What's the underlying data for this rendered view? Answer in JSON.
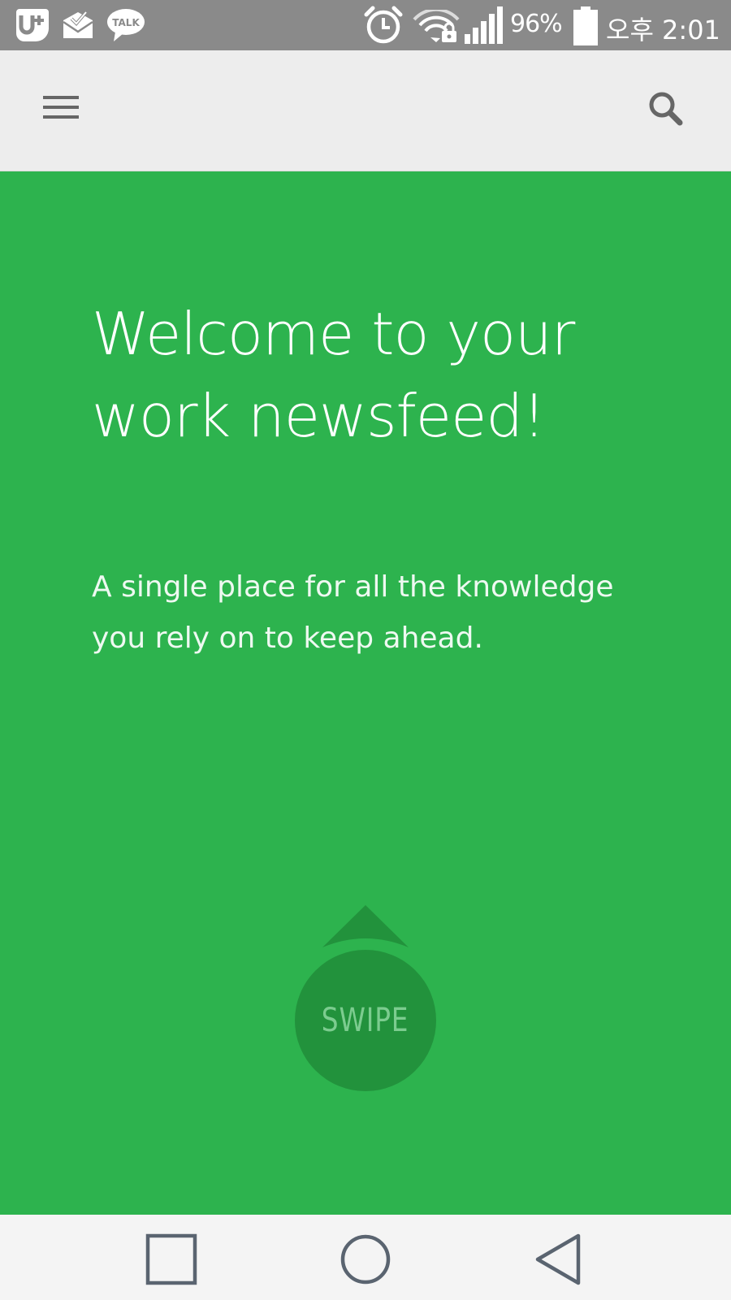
{
  "status_bar": {
    "battery": "96%",
    "time": "오후 2:01",
    "notification_icons": [
      "uplus-icon",
      "mail-check-icon",
      "kakaotalk-icon"
    ],
    "system_icons": [
      "alarm-icon",
      "wifi-lock-icon",
      "signal-icon",
      "battery-icon"
    ],
    "talk_badge": "TALK"
  },
  "app_bar": {
    "menu_icon": "menu-icon",
    "search_icon": "search-icon"
  },
  "onboarding": {
    "headline_line1": "Welcome to your",
    "headline_line2": "work newsfeed!",
    "subtitle_line1": "A single place for all the knowledge",
    "subtitle_line2": "you rely on to keep ahead.",
    "swipe_label": "SWIPE"
  },
  "nav_bar": {
    "buttons": [
      "recent-apps-icon",
      "home-icon",
      "back-icon"
    ]
  },
  "colors": {
    "accent": "#2db34e",
    "swipe_circle": "#22923c",
    "status_bar": "#8a8a8a",
    "app_bar": "#ededed",
    "nav_bar": "#f4f4f4"
  }
}
